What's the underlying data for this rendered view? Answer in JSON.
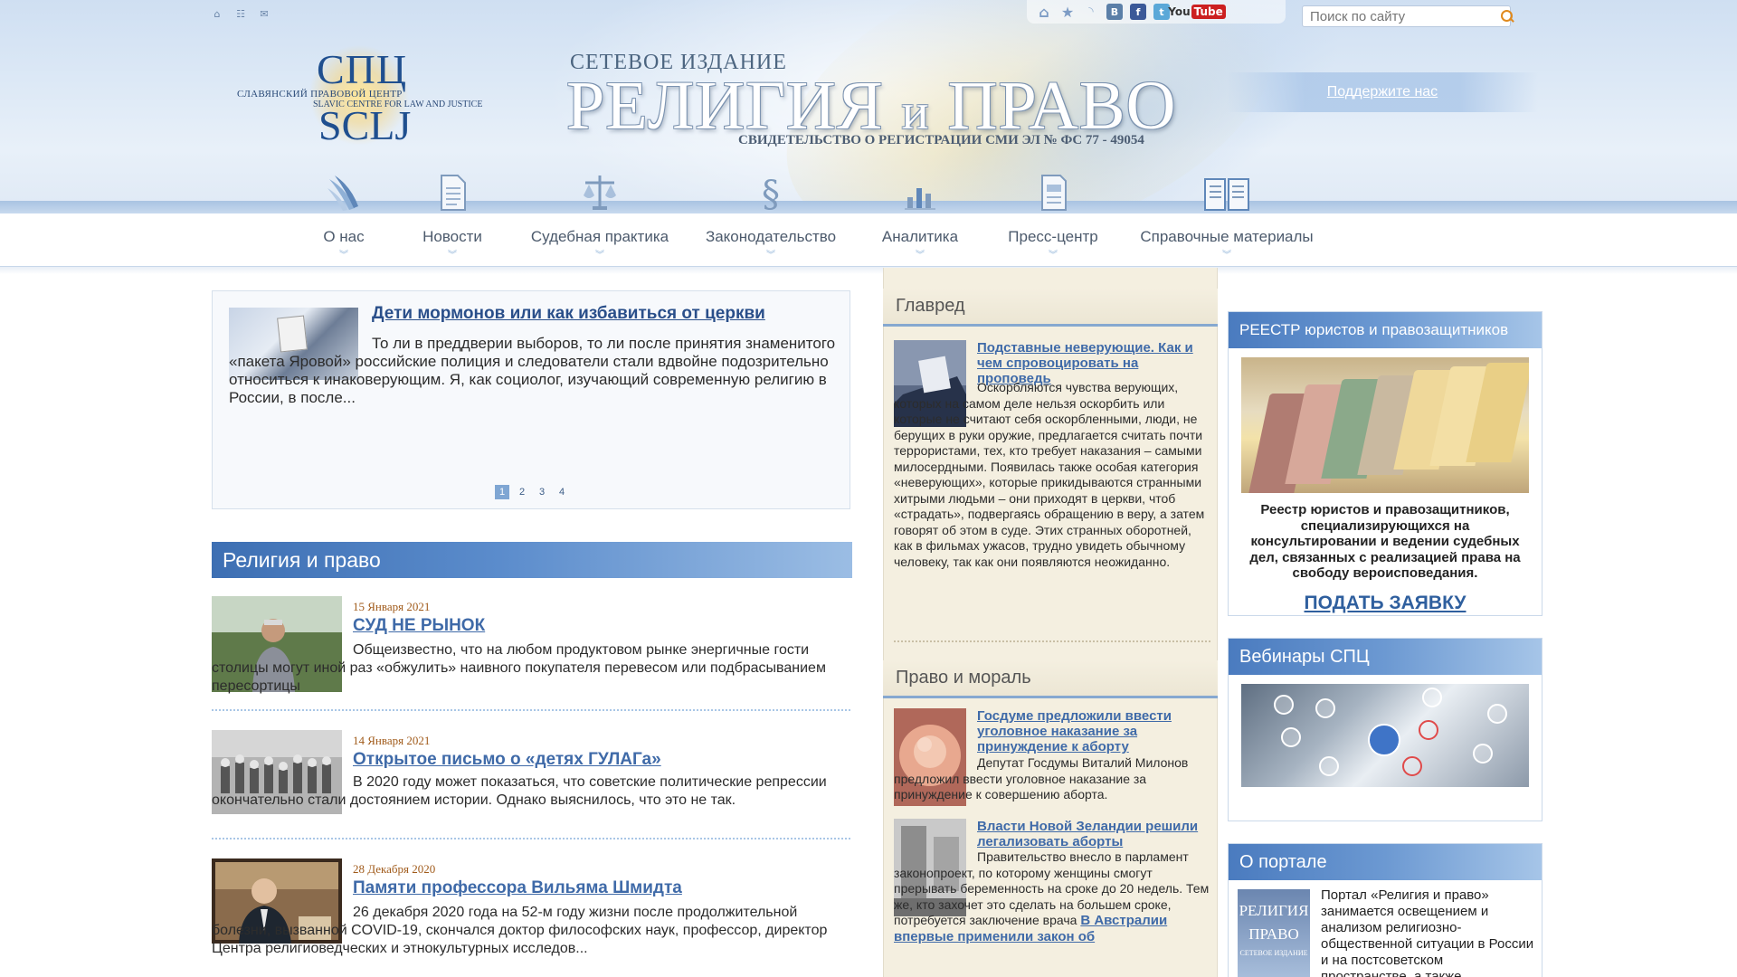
{
  "header": {
    "top_icons": [
      "home-icon",
      "sitemap-icon",
      "mail-icon"
    ],
    "social_icons": [
      "home-icon",
      "star-icon",
      "rss-icon",
      "vk-icon",
      "facebook-icon",
      "twitter-icon",
      "youtube-icon"
    ],
    "social_labels": {
      "vk": "В",
      "fb": "f",
      "tw": "t",
      "yt_you": "You",
      "yt_tube": "Tube"
    },
    "search_placeholder": "Поиск по сайту",
    "logo": {
      "top": "СПЦ",
      "bottom": "SCLJ",
      "ru": "СЛАВЯНСКИЙ ПРАВОВОЙ ЦЕНТР",
      "en": "SLAVIC CENTRE FOR LAW AND JUSTICE"
    },
    "masthead_sub": "СЕТЕВОЕ ИЗДАНИЕ",
    "masthead_word1": "РЕЛИГИЯ",
    "masthead_and": "и",
    "masthead_word2": "ПРАВО",
    "masthead_reg": "СВИДЕТЕЛЬСТВО О РЕГИСТРАЦИИ СМИ ЭЛ № ФС 77 - 49054",
    "support_link": "Поддержите нас"
  },
  "nav": [
    {
      "label": "О нас",
      "icon": "wings-icon"
    },
    {
      "label": "Новости",
      "icon": "document-icon"
    },
    {
      "label": "Судебная практика",
      "icon": "scales-icon"
    },
    {
      "label": "Законодательство",
      "icon": "section-sign-icon"
    },
    {
      "label": "Аналитика",
      "icon": "bar-chart-icon"
    },
    {
      "label": "Пресс-центр",
      "icon": "press-document-icon"
    },
    {
      "label": "Справочные материалы",
      "icon": "open-book-icon"
    }
  ],
  "featured": {
    "title": "Дети мормонов или как избавиться от церкви",
    "text": "То ли в преддверии выборов, то ли после принятия знаменитого «пакета Яровой» российские полиция и следователи стали вдвойне подозрительно относиться к инаковерующим. Я, как социолог, изучающий современную религию в России, в после...",
    "pages": [
      "1",
      "2",
      "3",
      "4"
    ],
    "active_page": "1"
  },
  "section": {
    "title": "Религия и право",
    "items": [
      {
        "date": "15 Января 2021",
        "title": "СУД НЕ РЫНОК",
        "text": "Общеизвестно, что на любом продуктовом рынке энергичные гости столицы могут иной раз «обжулить» наивного покупателя перевесом или подбрасыванием пересортицы"
      },
      {
        "date": "14 Января 2021",
        "title": "Открытое письмо о «детях ГУЛАГа»",
        "text": "В 2020 году может показаться, что советские политические репрессии окончательно стали достоянием истории. Однако выяснилось, что это не так."
      },
      {
        "date": "28 Декабря 2020",
        "title": "Памяти профессора Вильяма Шмидта",
        "text": "26 декабря 2020 года на 52-м году жизни после продолжительной болезни, вызванной COVID-19, скончался доктор философских наук, профессор, директор Центра религиоведческих и этнокультурных исследов..."
      }
    ]
  },
  "glavred": {
    "title": "Главред",
    "item_title": "Подставные неверующие. Как и чем спровоцировать на проповедь",
    "item_text": "Оскорбляются чувства верующих, которых на самом деле нельзя оскорбить или которые не считают себя оскорбленными, люди, не берущих в руки оружие, предлагается считать почти террористами, тех, кто требует наказания – самыми милосердными. Появилась также особая категория «неверующих», которые прикидываются странными хитрыми людьми – они приходят в церкви, чтоб «страдать», подвергаясь обращению в веру, а затем говорят об этом в суде. Этих странных оборотней, как в фильмах ужасов, трудно увидеть обычному человеку, так как они появляются неожиданно."
  },
  "pravo_moral": {
    "title": "Право и мораль",
    "items": [
      {
        "title": "Госдуме предложили ввести уголовное наказание за принуждение к аборту",
        "text": "Депутат Госдумы Виталий Милонов предложил ввести уголовное наказание за принуждение к совершению аборта."
      },
      {
        "title": "Власти Новой Зеландии решили легализовать аборты",
        "text": "Правительство внесло в парламент законопроект, по которому женщины смогут прерывать беременность на сроке до 20 недель. Тем же, кто захочет это сделать на большем сроке, потребуется заключение врача",
        "inline_link": "В Австралии впервые применили закон об"
      }
    ]
  },
  "registry": {
    "title": "РЕЕСТР юристов и правозащитников",
    "desc": "Реестр юристов и правозащитников, специализирующихся на консультировании и ведении судебных дел, связанных с реализацией права на свободу вероисповедания.",
    "apply": "ПОДАТЬ ЗАЯВКУ"
  },
  "webinars": {
    "title": "Вебинары СПЦ"
  },
  "about": {
    "title": "О портале",
    "img_line1": "РЕЛИГИЯ",
    "img_line2": "ПРАВО",
    "img_line3": "СЕТЕВОЕ ИЗДАНИЕ",
    "text": "Портал «Религия и право» занимается освещением и анализом религиозно-общественной ситуации в России и на постсоветском пространстве, а также"
  }
}
